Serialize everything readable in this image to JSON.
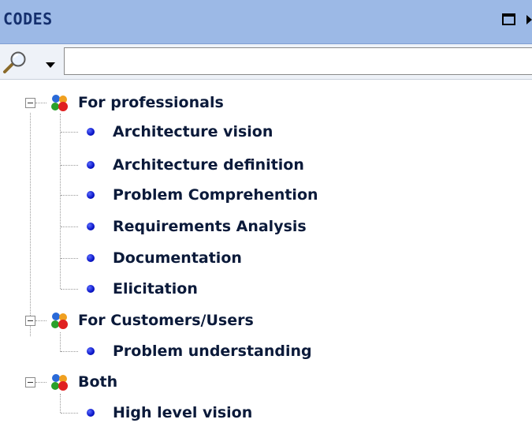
{
  "panel": {
    "title": "CODES",
    "icons": {
      "maximize": "maximize-icon",
      "more": "chevron-right-icon",
      "search": "magnifier-icon",
      "dropdown": "chevron-down-icon"
    }
  },
  "search": {
    "value": "",
    "placeholder": ""
  },
  "tree": {
    "groups": [
      {
        "label": "For professionals",
        "expanded": true,
        "icon": "code-group-icon",
        "items": [
          {
            "label": "Architecture vision",
            "icon": "code-bullet-icon"
          },
          {
            "label": "Architecture definition",
            "icon": "code-bullet-icon"
          },
          {
            "label": "Problem Comprehention",
            "icon": "code-bullet-icon"
          },
          {
            "label": "Requirements Analysis",
            "icon": "code-bullet-icon"
          },
          {
            "label": "Documentation",
            "icon": "code-bullet-icon"
          },
          {
            "label": "Elicitation",
            "icon": "code-bullet-icon"
          }
        ]
      },
      {
        "label": "For Customers/Users",
        "expanded": true,
        "icon": "code-group-icon",
        "items": [
          {
            "label": "Problem understanding",
            "icon": "code-bullet-icon"
          }
        ]
      },
      {
        "label": "Both",
        "expanded": true,
        "icon": "code-group-icon",
        "items": [
          {
            "label": "High level vision",
            "icon": "code-bullet-icon"
          }
        ]
      }
    ]
  },
  "colors": {
    "titlebar": "#9cb9e6",
    "title_text": "#15306e",
    "bullet": "#0a15c8",
    "label": "#0b1a3a"
  }
}
